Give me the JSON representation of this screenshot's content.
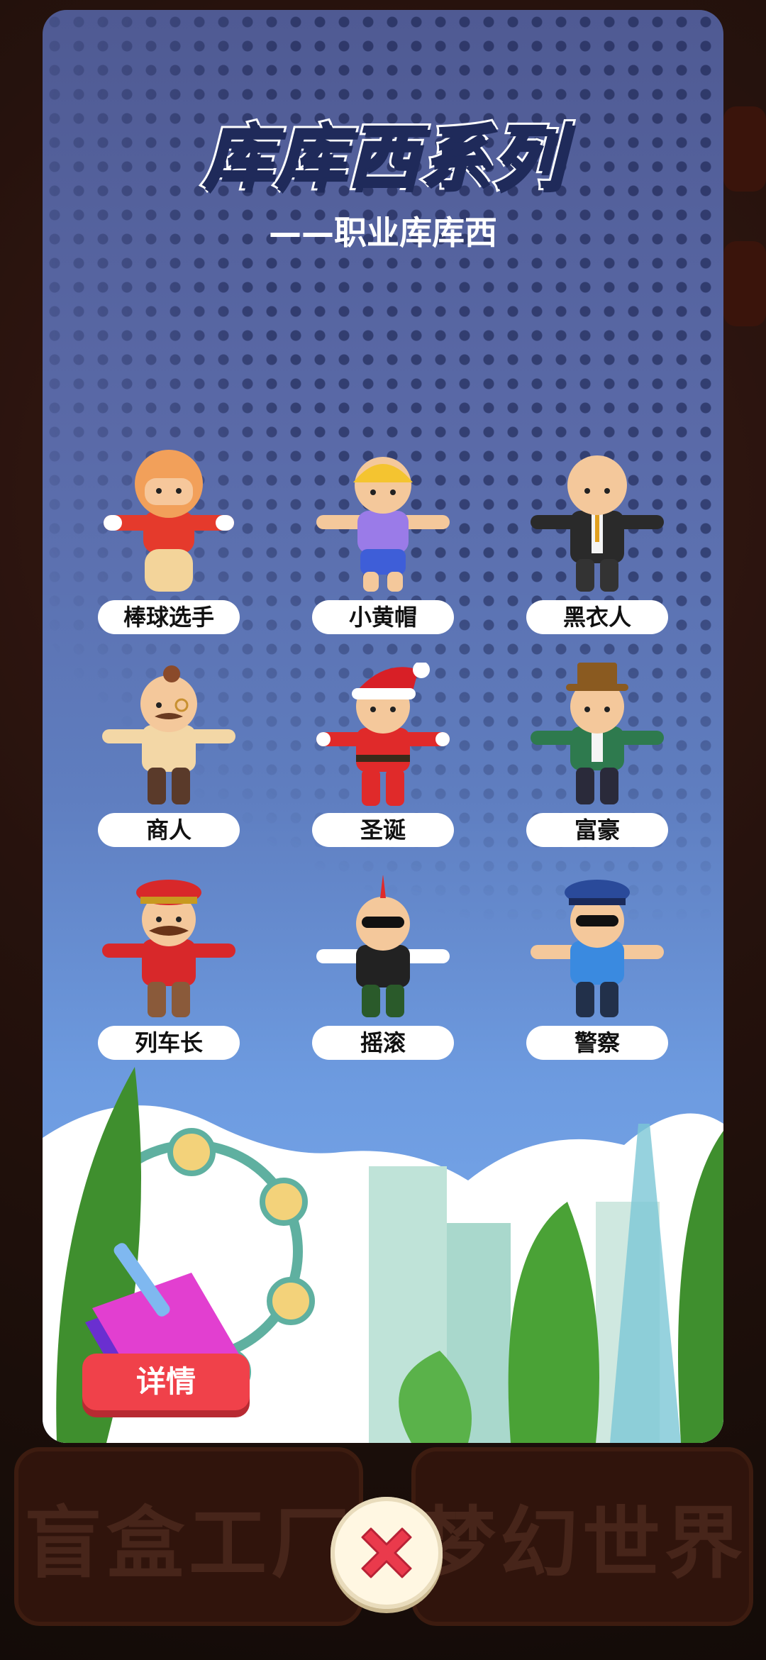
{
  "background": {
    "tiles": [
      "盲盒工厂",
      "梦幻世界"
    ]
  },
  "modal": {
    "title": "库库西系列",
    "subtitle": "——职业库库西",
    "characters": [
      {
        "label": "棒球选手",
        "icon": "baseball-player-figure"
      },
      {
        "label": "小黄帽",
        "icon": "yellow-cap-figure"
      },
      {
        "label": "黑衣人",
        "icon": "man-in-black-figure"
      },
      {
        "label": "商人",
        "icon": "merchant-figure"
      },
      {
        "label": "圣诞",
        "icon": "christmas-figure"
      },
      {
        "label": "富豪",
        "icon": "tycoon-figure"
      },
      {
        "label": "列车长",
        "icon": "conductor-figure"
      },
      {
        "label": "摇滚",
        "icon": "rocker-figure"
      },
      {
        "label": "警察",
        "icon": "police-figure"
      }
    ],
    "details_label": "详情",
    "close_icon": "close-icon"
  },
  "colors": {
    "accent_red": "#f0414a",
    "card_top": "#4f5a93",
    "card_bottom": "#7eaff0"
  }
}
